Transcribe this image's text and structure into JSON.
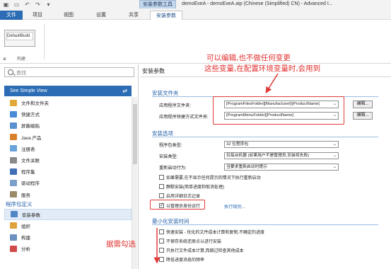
{
  "quick_access": [
    "save-icon",
    "folder-icon",
    "undo-icon",
    "redo-icon",
    "dropdown-icon"
  ],
  "context_tab": "安装参数工具",
  "window_title": "demoExeA - demoExeA.aip (Chinese (Simplified) CN) - Advanced I...",
  "tabs": [
    {
      "label": "文件"
    },
    {
      "label": "项目"
    },
    {
      "label": "视图"
    },
    {
      "label": "设置"
    },
    {
      "label": "共享"
    },
    {
      "label": "安装参数"
    }
  ],
  "ribbon": {
    "build_value": "DefaultBuild",
    "build_small": "⊕",
    "group_label": "构建"
  },
  "left": {
    "search_placeholder": "查找",
    "simple_view": "See Simple View",
    "items": [
      {
        "label": "文件和文件夹",
        "icon": "folder-icon",
        "color": "#e2a93a"
      },
      {
        "label": "快捷方式",
        "icon": "shortcut-icon",
        "color": "#4a8ad6"
      },
      {
        "label": "屏蔽磁贴",
        "icon": "tiles-icon",
        "color": "#5a8fd0"
      },
      {
        "label": "Java 产品",
        "icon": "java-icon",
        "color": "#d9822b"
      },
      {
        "label": "注册表",
        "icon": "registry-icon",
        "color": "#6aa2dc"
      },
      {
        "label": "文件关联",
        "icon": "file-assoc-icon",
        "color": "#8a8a8a"
      },
      {
        "label": "程序集",
        "icon": "assembly-icon",
        "color": "#3f6fb5"
      },
      {
        "label": "驱动程序",
        "icon": "driver-icon",
        "color": "#7a9fc9"
      },
      {
        "label": "服务",
        "icon": "service-icon",
        "color": "#9a8a6a"
      }
    ],
    "group2": "程序包定义",
    "items2": [
      {
        "label": "安装参数",
        "icon": "install-params-icon",
        "color": "#4f86c6",
        "selected": true
      },
      {
        "label": "组织",
        "icon": "organization-icon",
        "color": "#e0a23a"
      },
      {
        "label": "构建",
        "icon": "build-icon",
        "color": "#6b8fbf"
      },
      {
        "label": "分析",
        "icon": "analysis-icon",
        "color": "#d04a4a"
      }
    ]
  },
  "content": {
    "title": "安装参数",
    "section1": "安装文件夹",
    "app_folder_label": "应用程序文件夹:",
    "app_folder_value": "[ProgramFilesFolder][Manufacturer]\\[ProductName]",
    "shortcut_folder_label": "应用程序快捷方式文件夹:",
    "shortcut_folder_value": "[ProgramMenuFolder][ProductName]",
    "edit_label": "编辑...",
    "section2": "安装选项",
    "pkg_type_label": "程序包类型:",
    "pkg_type_value": "32 位程序包",
    "install_type_label": "安装类型:",
    "install_type_value": "仅每台机器 (如果用户不是管理员,安装将失败)",
    "reboot_label": "重新启动行为:",
    "reboot_value": "当要求重新启动时提示",
    "opt1": "如果需要,在不显示任何提示的情况下执行重新启动",
    "opt2": "静默安装(简单进度和取消处理)",
    "opt3": "启用详细日志记录",
    "opt4": "以管理员身份运行",
    "run_as_link": "执行级别...",
    "section3": "最小化安装时间",
    "opt5": "快速安装 - 优化的文件成本计算和复制,不确定的进度",
    "opt6": "不保存系统还原点以进行安装",
    "opt7": "只执行文件成本计算,而跳过检查其他成本",
    "opt8": "降低进度消息的频率"
  },
  "annotations": {
    "note1_line1": "可以编辑,也不做任何变更",
    "note1_line2": "这些变量,在配置环境变量时,会用到",
    "note2": "据需勾选"
  }
}
